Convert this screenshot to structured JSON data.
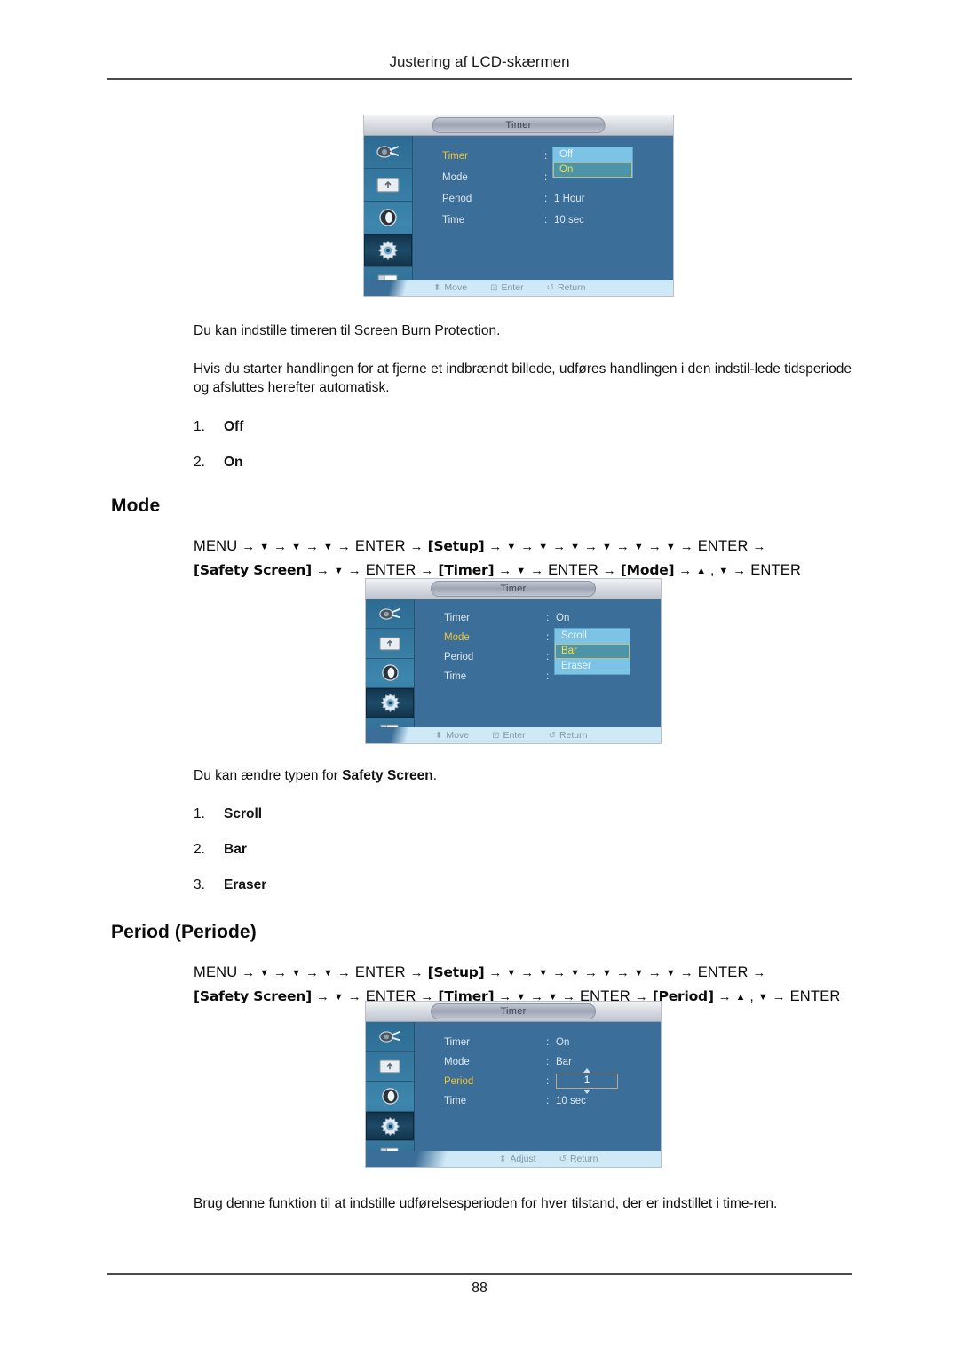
{
  "page": {
    "header": "Justering af LCD-skærmen",
    "number": "88"
  },
  "sections": [
    {
      "id": "timer",
      "paragraphs": [
        "Du kan indstille timeren til Screen Burn Protection.",
        "Hvis du starter handlingen for at fjerne et indbrændt billede, udføres handlingen i den indstil-lede tidsperiode og afsluttes herefter automatisk."
      ],
      "options": [
        {
          "num": "1.",
          "label": "Off"
        },
        {
          "num": "2.",
          "label": "On"
        }
      ]
    },
    {
      "id": "mode",
      "title": "Mode",
      "paragraph_prefix": "Du kan ændre typen for ",
      "paragraph_bold": "Safety Screen",
      "paragraph_suffix": ".",
      "options": [
        {
          "num": "1.",
          "label": "Scroll"
        },
        {
          "num": "2.",
          "label": "Bar"
        },
        {
          "num": "3.",
          "label": "Eraser"
        }
      ]
    },
    {
      "id": "period",
      "title": "Period (Periode)",
      "paragraph": "Brug denne funktion til at indstille udførelsesperioden for hver tilstand, der er indstillet i time-ren."
    }
  ],
  "menu_paths": {
    "mode": {
      "line1": [
        {
          "t": "MENU",
          "k": "key"
        },
        {
          "t": "→",
          "k": "arrow"
        },
        {
          "t": "▼",
          "k": "dn"
        },
        {
          "t": "→",
          "k": "arrow"
        },
        {
          "t": "▼",
          "k": "dn"
        },
        {
          "t": "→",
          "k": "arrow"
        },
        {
          "t": "▼",
          "k": "dn"
        },
        {
          "t": "→",
          "k": "arrow"
        },
        {
          "t": "ENTER",
          "k": "key"
        },
        {
          "t": "→",
          "k": "arrow"
        },
        {
          "t": "[Setup]",
          "k": "brk"
        },
        {
          "t": "→",
          "k": "arrow"
        },
        {
          "t": "▼",
          "k": "dn"
        },
        {
          "t": "→",
          "k": "arrow"
        },
        {
          "t": "▼",
          "k": "dn"
        },
        {
          "t": "→",
          "k": "arrow"
        },
        {
          "t": "▼",
          "k": "dn"
        },
        {
          "t": "→",
          "k": "arrow"
        },
        {
          "t": "▼",
          "k": "dn"
        },
        {
          "t": "→",
          "k": "arrow"
        },
        {
          "t": "▼",
          "k": "dn"
        },
        {
          "t": "→",
          "k": "arrow"
        },
        {
          "t": "▼",
          "k": "dn"
        },
        {
          "t": "→",
          "k": "arrow"
        },
        {
          "t": "ENTER",
          "k": "key"
        },
        {
          "t": "→",
          "k": "arrow"
        }
      ],
      "line2": [
        {
          "t": "[Safety Screen]",
          "k": "brk"
        },
        {
          "t": "→",
          "k": "arrow"
        },
        {
          "t": "▼",
          "k": "dn"
        },
        {
          "t": "→",
          "k": "arrow"
        },
        {
          "t": "ENTER",
          "k": "key"
        },
        {
          "t": "→",
          "k": "arrow"
        },
        {
          "t": "[Timer]",
          "k": "brk"
        },
        {
          "t": "→",
          "k": "arrow"
        },
        {
          "t": "▼",
          "k": "dn"
        },
        {
          "t": "→",
          "k": "arrow"
        },
        {
          "t": "ENTER",
          "k": "key"
        },
        {
          "t": "→",
          "k": "arrow"
        },
        {
          "t": "[Mode]",
          "k": "brk"
        },
        {
          "t": "→",
          "k": "arrow"
        },
        {
          "t": "▲",
          "k": "up"
        },
        {
          "t": ",",
          "k": "arrow"
        },
        {
          "t": "▼",
          "k": "dn"
        },
        {
          "t": "→",
          "k": "arrow"
        },
        {
          "t": "ENTER",
          "k": "key"
        }
      ]
    },
    "period": {
      "line1": [
        {
          "t": "MENU",
          "k": "key"
        },
        {
          "t": "→",
          "k": "arrow"
        },
        {
          "t": "▼",
          "k": "dn"
        },
        {
          "t": "→",
          "k": "arrow"
        },
        {
          "t": "▼",
          "k": "dn"
        },
        {
          "t": "→",
          "k": "arrow"
        },
        {
          "t": "▼",
          "k": "dn"
        },
        {
          "t": "→",
          "k": "arrow"
        },
        {
          "t": "ENTER",
          "k": "key"
        },
        {
          "t": "→",
          "k": "arrow"
        },
        {
          "t": "[Setup]",
          "k": "brk"
        },
        {
          "t": "→",
          "k": "arrow"
        },
        {
          "t": "▼",
          "k": "dn"
        },
        {
          "t": "→",
          "k": "arrow"
        },
        {
          "t": "▼",
          "k": "dn"
        },
        {
          "t": "→",
          "k": "arrow"
        },
        {
          "t": "▼",
          "k": "dn"
        },
        {
          "t": "→",
          "k": "arrow"
        },
        {
          "t": "▼",
          "k": "dn"
        },
        {
          "t": "→",
          "k": "arrow"
        },
        {
          "t": "▼",
          "k": "dn"
        },
        {
          "t": "→",
          "k": "arrow"
        },
        {
          "t": "▼",
          "k": "dn"
        },
        {
          "t": "→",
          "k": "arrow"
        },
        {
          "t": "ENTER",
          "k": "key"
        },
        {
          "t": "→",
          "k": "arrow"
        }
      ],
      "line2": [
        {
          "t": "[Safety Screen]",
          "k": "brk"
        },
        {
          "t": "→",
          "k": "arrow"
        },
        {
          "t": "▼",
          "k": "dn"
        },
        {
          "t": "→",
          "k": "arrow"
        },
        {
          "t": "ENTER",
          "k": "key"
        },
        {
          "t": "→",
          "k": "arrow"
        },
        {
          "t": "[Timer]",
          "k": "brk"
        },
        {
          "t": "→",
          "k": "arrow"
        },
        {
          "t": "▼",
          "k": "dn"
        },
        {
          "t": "→",
          "k": "arrow"
        },
        {
          "t": "▼",
          "k": "dn"
        },
        {
          "t": "→",
          "k": "arrow"
        },
        {
          "t": "ENTER",
          "k": "key"
        },
        {
          "t": "→",
          "k": "arrow"
        },
        {
          "t": "[Period]",
          "k": "brk"
        },
        {
          "t": "→",
          "k": "arrow"
        },
        {
          "t": "▲",
          "k": "up"
        },
        {
          "t": ",",
          "k": "arrow"
        },
        {
          "t": "▼",
          "k": "dn"
        },
        {
          "t": "→",
          "k": "arrow"
        },
        {
          "t": "ENTER",
          "k": "key"
        }
      ]
    }
  },
  "osd_screens": [
    {
      "id": "osd-timer",
      "title": "Timer",
      "sidebar_icons": [
        "input-source-icon",
        "picture-icon",
        "sound-icon",
        "setup-gear-icon",
        "multi-control-icon"
      ],
      "selected_sidebar_index": 3,
      "rows": [
        {
          "label": "Timer",
          "active": true,
          "value": ""
        },
        {
          "label": "Mode",
          "active": false,
          "value": ""
        },
        {
          "label": "Period",
          "active": false,
          "value": "1 Hour"
        },
        {
          "label": "Time",
          "active": false,
          "value": "10 sec"
        }
      ],
      "dropdown": {
        "items": [
          "Off",
          "On"
        ],
        "selected": "On"
      },
      "footer": [
        {
          "glyph": "⬍",
          "label": "Move",
          "icon": "updown-icon"
        },
        {
          "glyph": "↵",
          "label": "Enter",
          "icon": "enter-icon"
        },
        {
          "glyph": "↺",
          "label": "Return",
          "icon": "return-icon"
        }
      ]
    },
    {
      "id": "osd-mode",
      "title": "Timer",
      "sidebar_icons": [
        "input-source-icon",
        "picture-icon",
        "sound-icon",
        "setup-gear-icon",
        "multi-control-icon"
      ],
      "selected_sidebar_index": 3,
      "rows": [
        {
          "label": "Timer",
          "active": false,
          "value": "On"
        },
        {
          "label": "Mode",
          "active": true,
          "value": ""
        },
        {
          "label": "Period",
          "active": false,
          "value": ""
        },
        {
          "label": "Time",
          "active": false,
          "value": ""
        }
      ],
      "dropdown": {
        "items": [
          "Scroll",
          "Bar",
          "Eraser"
        ],
        "selected": "Bar"
      },
      "footer": [
        {
          "glyph": "⬍",
          "label": "Move",
          "icon": "updown-icon"
        },
        {
          "glyph": "↵",
          "label": "Enter",
          "icon": "enter-icon"
        },
        {
          "glyph": "↺",
          "label": "Return",
          "icon": "return-icon"
        }
      ]
    },
    {
      "id": "osd-period",
      "title": "Timer",
      "sidebar_icons": [
        "input-source-icon",
        "picture-icon",
        "sound-icon",
        "setup-gear-icon",
        "multi-control-icon"
      ],
      "selected_sidebar_index": 3,
      "rows": [
        {
          "label": "Timer",
          "active": false,
          "value": "On"
        },
        {
          "label": "Mode",
          "active": false,
          "value": "Bar"
        },
        {
          "label": "Period",
          "active": true,
          "value": ""
        },
        {
          "label": "Time",
          "active": false,
          "value": "10 sec"
        }
      ],
      "spinner": {
        "value": "1"
      },
      "footer": [
        {
          "glyph": "⬍",
          "label": "Adjust",
          "icon": "updown-icon"
        },
        {
          "glyph": "↺",
          "label": "Return",
          "icon": "return-icon"
        }
      ]
    }
  ],
  "colors": {
    "osd_body": "#3b6e98",
    "osd_sidebar": "#3d86ad",
    "active_label": "#f5c32c",
    "dropdown_bg": "#7cc3e6",
    "dropdown_selected_bg": "#4e94a8",
    "dropdown_selected_text": "#f5e04a",
    "footer_bg": "#cfeaf6"
  }
}
